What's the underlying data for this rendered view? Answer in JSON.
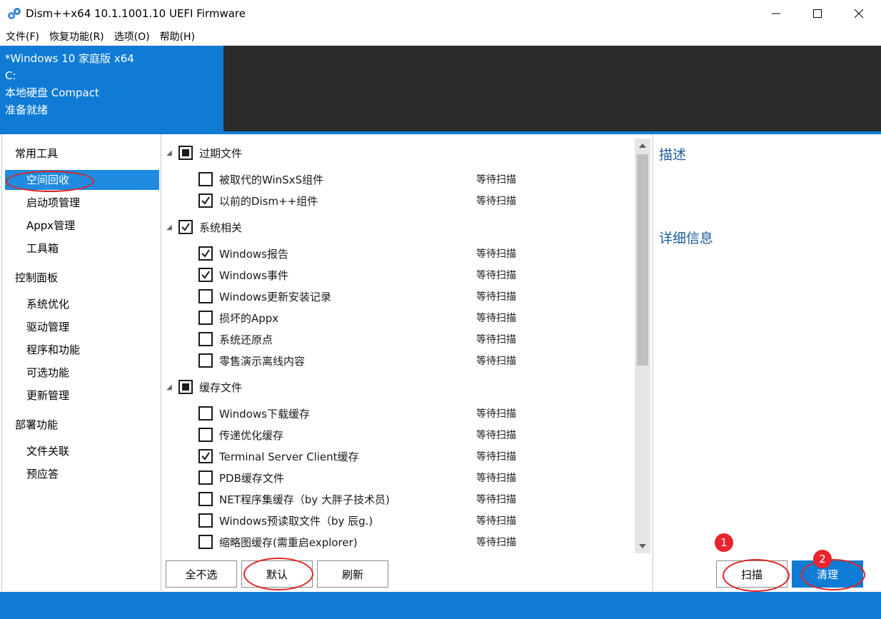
{
  "window": {
    "title": "Dism++x64 10.1.1001.10 UEFI Firmware",
    "app_icon": "gears-icon"
  },
  "menu": [
    "文件(F)",
    "恢复功能(R)",
    "选项(O)",
    "帮助(H)"
  ],
  "banner": {
    "os": "*Windows 10 家庭版 x64",
    "drive": "C:",
    "disk": "本地硬盘 Compact",
    "status": "准备就绪"
  },
  "sidebar": {
    "groups": [
      {
        "label": "常用工具",
        "items": [
          "空间回收",
          "启动项管理",
          "Appx管理",
          "工具箱"
        ]
      },
      {
        "label": "控制面板",
        "items": [
          "系统优化",
          "驱动管理",
          "程序和功能",
          "可选功能",
          "更新管理"
        ]
      },
      {
        "label": "部署功能",
        "items": [
          "文件关联",
          "预应答"
        ]
      }
    ],
    "active": "空间回收"
  },
  "categories": [
    {
      "label": "过期文件",
      "state": "partial",
      "items": [
        {
          "label": "被取代的WinSxS组件",
          "checked": false,
          "status": "等待扫描"
        },
        {
          "label": "以前的Dism++组件",
          "checked": true,
          "status": "等待扫描"
        }
      ]
    },
    {
      "label": "系统相关",
      "state": "checked",
      "items": [
        {
          "label": "Windows报告",
          "checked": true,
          "status": "等待扫描"
        },
        {
          "label": "Windows事件",
          "checked": true,
          "status": "等待扫描"
        },
        {
          "label": "Windows更新安装记录",
          "checked": false,
          "status": "等待扫描"
        },
        {
          "label": "损坏的Appx",
          "checked": false,
          "status": "等待扫描"
        },
        {
          "label": "系统还原点",
          "checked": false,
          "status": "等待扫描"
        },
        {
          "label": "零售演示离线内容",
          "checked": false,
          "status": "等待扫描"
        }
      ]
    },
    {
      "label": "缓存文件",
      "state": "partial",
      "items": [
        {
          "label": "Windows下载缓存",
          "checked": false,
          "status": "等待扫描"
        },
        {
          "label": "传递优化缓存",
          "checked": false,
          "status": "等待扫描"
        },
        {
          "label": "Terminal Server Client缓存",
          "checked": true,
          "status": "等待扫描"
        },
        {
          "label": "PDB缓存文件",
          "checked": false,
          "status": "等待扫描"
        },
        {
          "label": "NET程序集缓存（by 大胖子技术员)",
          "checked": false,
          "status": "等待扫描"
        },
        {
          "label": "Windows预读取文件（by 辰g.)",
          "checked": false,
          "status": "等待扫描"
        },
        {
          "label": "缩略图缓存(需重启explorer)",
          "checked": false,
          "status": "等待扫描"
        }
      ]
    }
  ],
  "right_panel": {
    "description_heading": "描述",
    "details_heading": "详细信息"
  },
  "buttons": {
    "select_none": "全不选",
    "default": "默认",
    "refresh": "刷新",
    "scan": "扫描",
    "clean": "清理"
  },
  "badges": {
    "scan": "1",
    "clean": "2"
  },
  "colors": {
    "accent": "#0f7bd4",
    "banner_dark": "#2b2b2b",
    "annotation_red": "#e02424",
    "heading_blue": "#1c5c9c"
  }
}
